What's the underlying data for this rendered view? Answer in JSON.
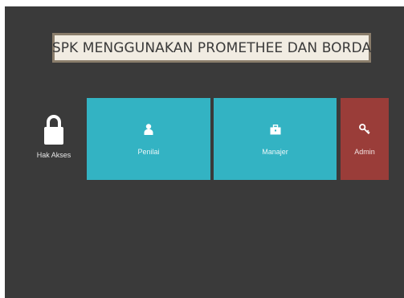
{
  "app": {
    "title": "SPK MENGGUNAKAN PROMETHEE DAN BORDA"
  },
  "access": {
    "label": "Hak Akses",
    "icon": "lock-icon"
  },
  "roles": [
    {
      "label": "Penilai",
      "icon": "user-icon",
      "color": "#33b3c3"
    },
    {
      "label": "Manajer",
      "icon": "briefcase-icon",
      "color": "#33b3c3"
    },
    {
      "label": "Admin",
      "icon": "key-icon",
      "color": "#9a3d39"
    }
  ],
  "colors": {
    "background": "#3a3a3a",
    "tile_primary": "#33b3c3",
    "tile_admin": "#9a3d39",
    "title_bg": "#f1ece2",
    "title_border": "#8a7d6b"
  }
}
